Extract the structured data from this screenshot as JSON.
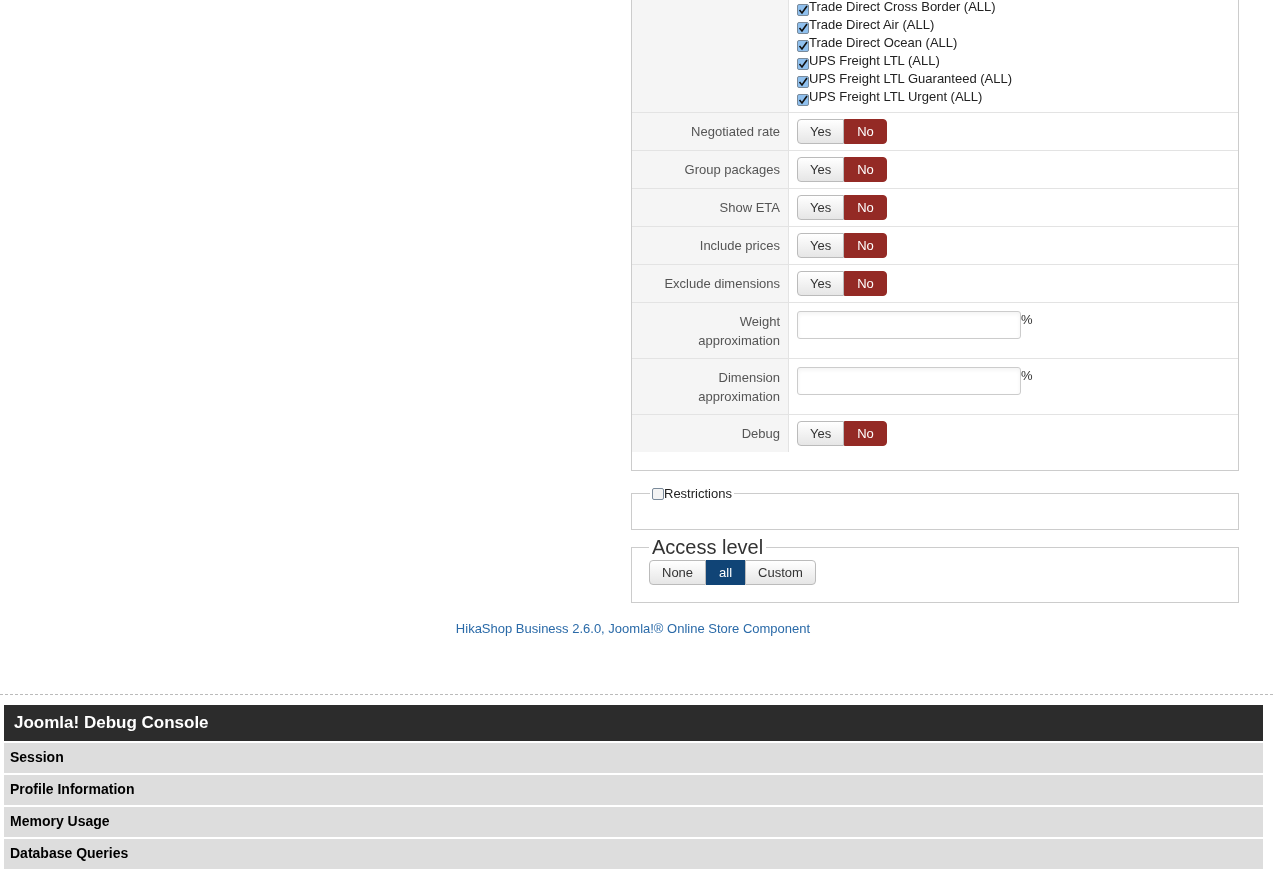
{
  "services": [
    {
      "label": "Trade Direct Cross Border (ALL)",
      "checked": true
    },
    {
      "label": "Trade Direct Air (ALL)",
      "checked": true
    },
    {
      "label": "Trade Direct Ocean (ALL)",
      "checked": true
    },
    {
      "label": "UPS Freight LTL (ALL)",
      "checked": true
    },
    {
      "label": "UPS Freight LTL Guaranteed (ALL)",
      "checked": true
    },
    {
      "label": "UPS Freight LTL Urgent (ALL)",
      "checked": true
    }
  ],
  "settings": [
    {
      "kind": "toggle",
      "label": "Negotiated rate",
      "options": [
        {
          "label": "Yes",
          "selected": false
        },
        {
          "label": "No",
          "selected": true
        }
      ]
    },
    {
      "kind": "toggle",
      "label": "Group packages",
      "options": [
        {
          "label": "Yes",
          "selected": false
        },
        {
          "label": "No",
          "selected": true
        }
      ]
    },
    {
      "kind": "toggle",
      "label": "Show ETA",
      "options": [
        {
          "label": "Yes",
          "selected": false
        },
        {
          "label": "No",
          "selected": true
        }
      ]
    },
    {
      "kind": "toggle",
      "label": "Include prices",
      "options": [
        {
          "label": "Yes",
          "selected": false
        },
        {
          "label": "No",
          "selected": true
        }
      ]
    },
    {
      "kind": "toggle",
      "label": "Exclude dimensions",
      "options": [
        {
          "label": "Yes",
          "selected": false
        },
        {
          "label": "No",
          "selected": true
        }
      ]
    },
    {
      "kind": "input",
      "label": "Weight approximation",
      "suffix": "%"
    },
    {
      "kind": "input",
      "label": "Dimension approximation",
      "suffix": "%"
    },
    {
      "kind": "toggle",
      "label": "Debug",
      "options": [
        {
          "label": "Yes",
          "selected": false
        },
        {
          "label": "No",
          "selected": true
        }
      ]
    }
  ],
  "restrictions": {
    "label": "Restrictions",
    "checked": false
  },
  "access_level": {
    "title": "Access level",
    "options": [
      {
        "label": "None",
        "selected": false
      },
      {
        "label": "all",
        "selected": true
      },
      {
        "label": "Custom",
        "selected": false
      }
    ]
  },
  "footer_link": "HikaShop Business 2.6.0, Joomla!® Online Store Component",
  "debug_console": {
    "title": "Joomla! Debug Console",
    "sections": [
      "Session",
      "Profile Information",
      "Memory Usage",
      "Database Queries"
    ]
  }
}
